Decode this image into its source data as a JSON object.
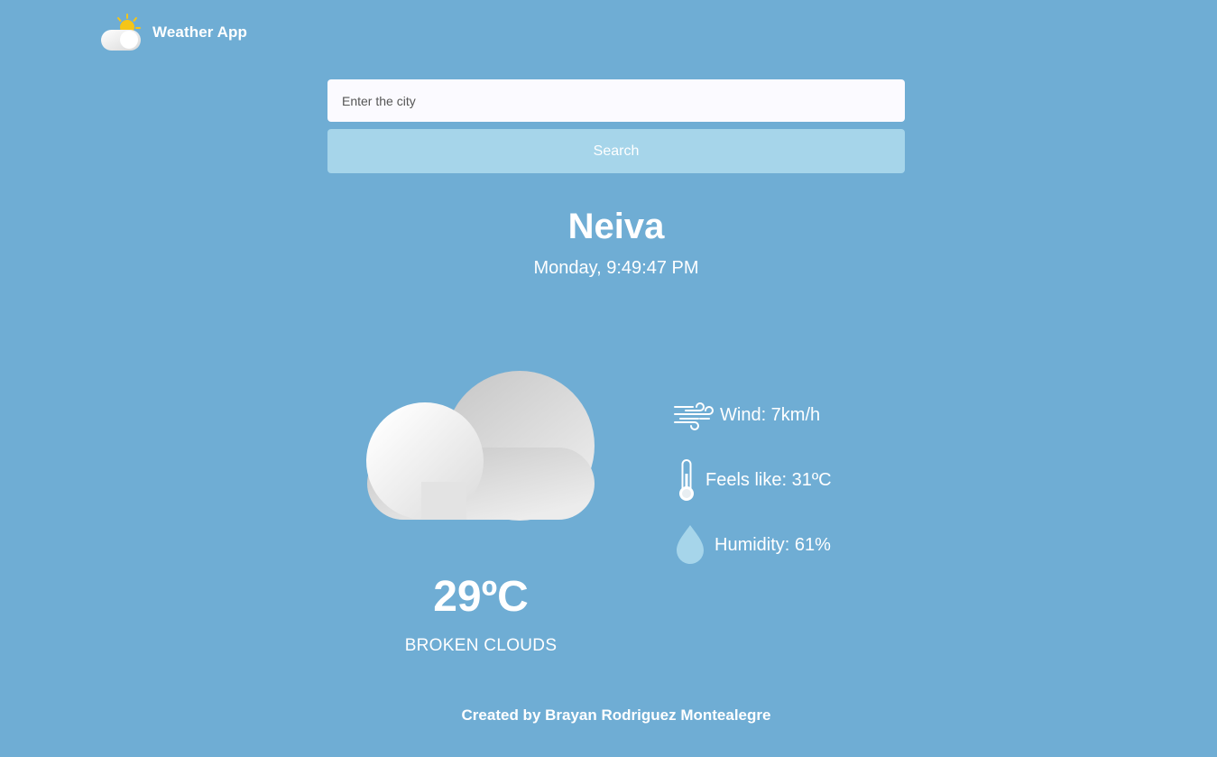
{
  "header": {
    "app_title": "Weather App",
    "logo_icon": "sun-cloud-icon"
  },
  "search": {
    "placeholder": "Enter the city",
    "value": "",
    "button_label": "Search"
  },
  "location": {
    "city": "Neiva",
    "datetime": "Monday, 9:49:47 PM"
  },
  "current": {
    "icon": "broken-clouds-icon",
    "temperature": "29ºC",
    "description": "BROKEN CLOUDS"
  },
  "details": {
    "wind": {
      "label": "Wind: 7km/h",
      "icon": "wind-icon"
    },
    "feels_like": {
      "label": "Feels like: 31ºC",
      "icon": "thermometer-icon"
    },
    "humidity": {
      "label": "Humidity: 61%",
      "icon": "water-drop-icon"
    }
  },
  "footer": {
    "credit": "Created by Brayan Rodriguez Montealegre"
  },
  "colors": {
    "background": "#6fadd4",
    "input_background": "#fbfaff",
    "button_background": "#a6d5ea",
    "text": "#ffffff",
    "sun": "#f5c518",
    "drop": "#a6d5ea"
  }
}
